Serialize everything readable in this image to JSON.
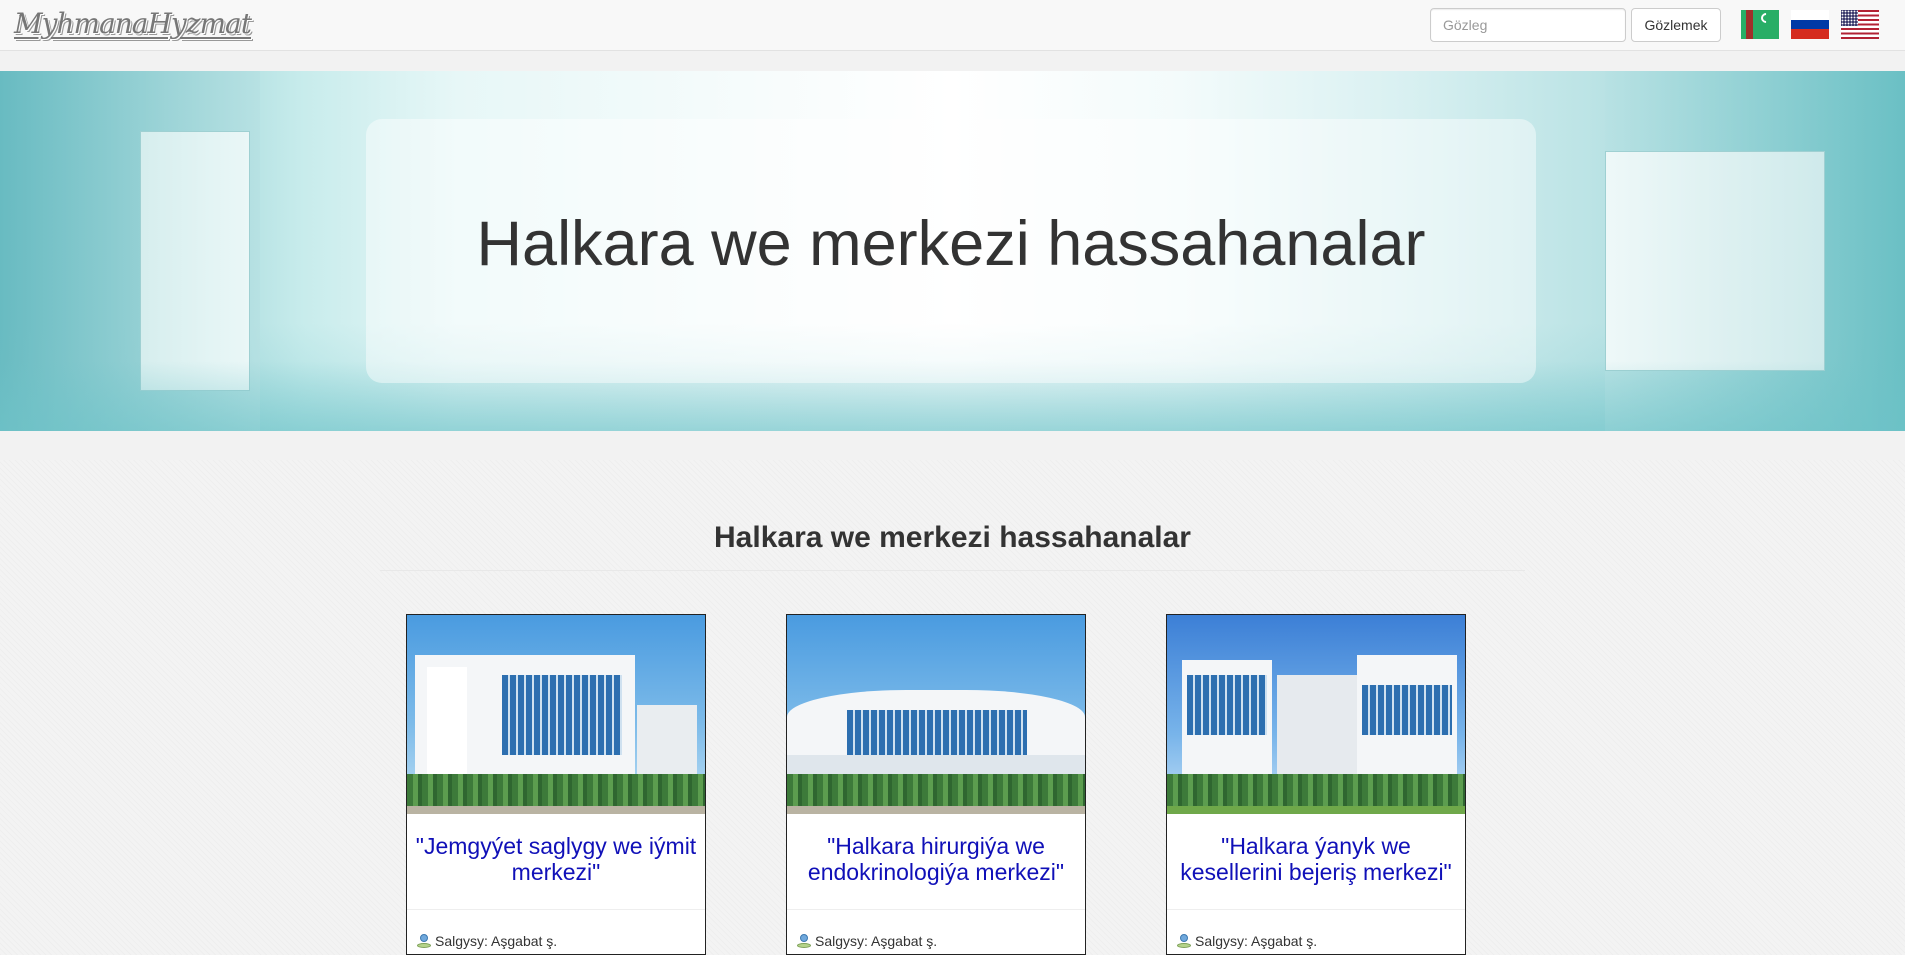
{
  "navbar": {
    "brand": "MyhmanaHyzmat",
    "search": {
      "placeholder": "Gözleg",
      "value": ""
    },
    "search_button": "Gözlemek",
    "languages": [
      {
        "name": "turkmen-flag-icon"
      },
      {
        "name": "russian-flag-icon"
      },
      {
        "name": "us-flag-icon"
      }
    ]
  },
  "hero": {
    "title": "Halkara we merkezi hassahanalar"
  },
  "section": {
    "title": "Halkara we merkezi hassahanalar",
    "cards": [
      {
        "title": "\"Jemgyýet saglygy we iýmit merkezi\"",
        "address_label": "Salgysy: Aşgabat ş."
      },
      {
        "title": "\"Halkara hirurgiýa we endokrinologiýa merkezi\"",
        "address_label": "Salgysy: Aşgabat ş."
      },
      {
        "title": "\"Halkara ýanyk we kesellerini bejeriş merkezi\"",
        "address_label": "Salgysy: Aşgabat ş."
      }
    ]
  },
  "colors": {
    "card_title": "#1010b8",
    "navbar_bg": "#f8f8f8",
    "hero_accent": "#6cbcc2"
  }
}
